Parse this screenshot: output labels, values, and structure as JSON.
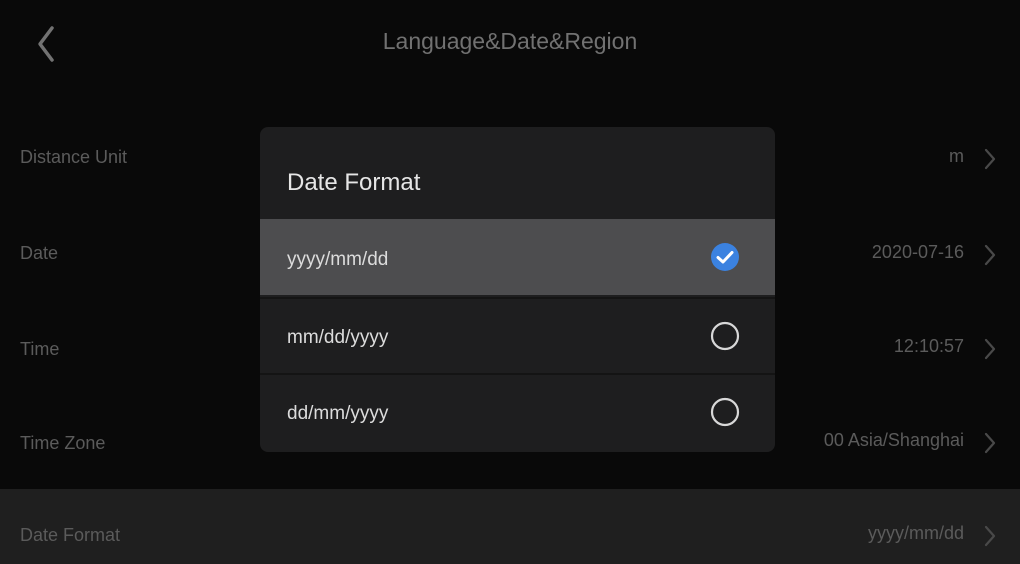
{
  "header": {
    "title": "Language&Date&Region",
    "back_icon": "chevron-left-icon"
  },
  "settings": [
    {
      "label": "Distance Unit",
      "value": "m"
    },
    {
      "label": "Date",
      "value": "2020-07-16"
    },
    {
      "label": "Time",
      "value": "12:10:57"
    },
    {
      "label": "Time Zone",
      "value": "00 Asia/Shanghai"
    },
    {
      "label": "Date Format",
      "value": "yyyy/mm/dd"
    }
  ],
  "dialog": {
    "title": "Date Format",
    "options": [
      {
        "label": "yyyy/mm/dd",
        "selected": true
      },
      {
        "label": "mm/dd/yyyy",
        "selected": false
      },
      {
        "label": "dd/mm/yyyy",
        "selected": false
      }
    ]
  },
  "colors": {
    "accent": "#3b82e0",
    "background": "#0b0b0b",
    "dialog_background": "#1e1e1f",
    "selected_option_background": "#4d4d4f",
    "highlighted_row_background": "#262626"
  }
}
